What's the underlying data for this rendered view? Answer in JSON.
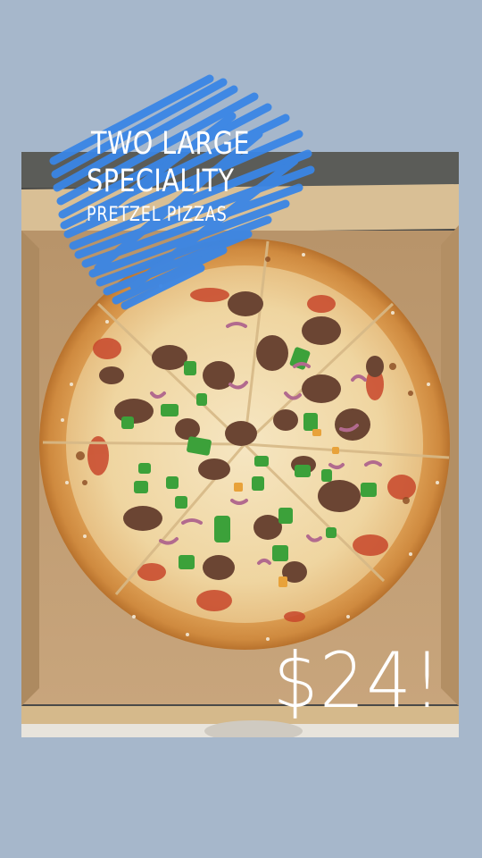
{
  "story": {
    "headline_line1": "TWO LARGE",
    "headline_line2": "SPECIALITY",
    "headline_line3": "PRETZEL PIZZAS",
    "price": "$24!"
  },
  "colors": {
    "background": "#a6b7cb",
    "scribble_blue": "#3a86e6",
    "box_cardboard": "#c7a57a",
    "crust": "#e0a862",
    "cheese": "#f1dcae",
    "sauce": "#c8472b",
    "sausage": "#6b4533",
    "green_pepper": "#3ca13a",
    "red_onion": "#b26a8e"
  },
  "photo": {
    "subject": "pizza-in-box"
  }
}
